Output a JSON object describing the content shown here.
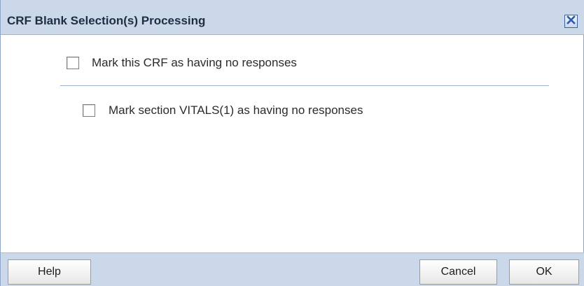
{
  "dialog": {
    "title": "CRF Blank Selection(s) Processing",
    "close_icon": "close-x-icon"
  },
  "options": {
    "crf_label": "Mark this CRF as having no responses",
    "crf_checked": false,
    "section_label": "Mark section VITALS(1) as having no responses",
    "section_checked": false
  },
  "footer": {
    "help_label": "Help",
    "cancel_label": "Cancel",
    "ok_label": "OK"
  },
  "colors": {
    "titlebar_bg": "#cbd8ea",
    "footer_bg": "#cbd8ea",
    "close_icon_color": "#2b5aa8"
  }
}
